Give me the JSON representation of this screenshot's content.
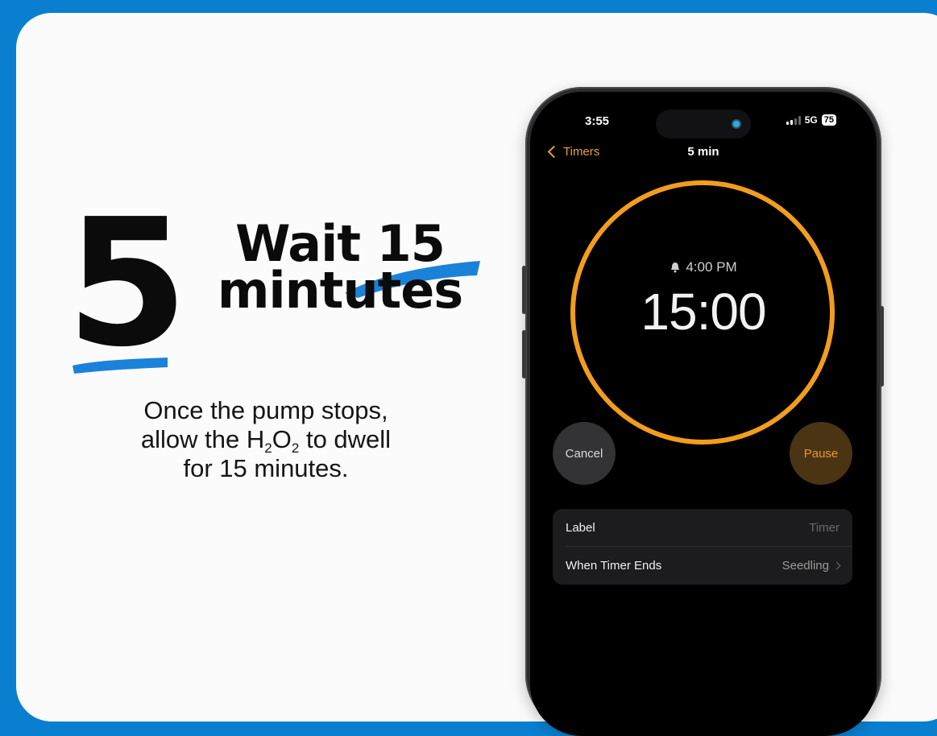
{
  "colors": {
    "background": "#0a7fd0",
    "card": "#fbfbfb",
    "accent_blue": "#1a82d8",
    "timer_orange": "#f29d1e",
    "ios_back_orange": "#e7a13a"
  },
  "step": {
    "number": "5",
    "title_line1": "Wait 15",
    "title_line2": "mintutes",
    "description_part1": "Once the pump stops,",
    "description_part2": "allow the H",
    "description_sub1": "2",
    "description_part3": "O",
    "description_sub2": "2",
    "description_part4": " to dwell",
    "description_part5": "for 15 minutes."
  },
  "phone": {
    "status_time": "3:55",
    "network": "5G",
    "battery": "75",
    "nav_back_label": "Timers",
    "nav_title": "5 min",
    "alarm_time": "4:00 PM",
    "countdown": "15:00",
    "cancel_label": "Cancel",
    "pause_label": "Pause",
    "settings": [
      {
        "label": "Label",
        "value": "Timer"
      },
      {
        "label": "When Timer Ends",
        "value": "Seedling"
      }
    ],
    "icons": {
      "back": "chevron-left-icon",
      "alarm": "bell-icon",
      "disclosure": "chevron-right-icon",
      "signal": "cellular-signal-icon",
      "battery": "battery-icon"
    }
  }
}
